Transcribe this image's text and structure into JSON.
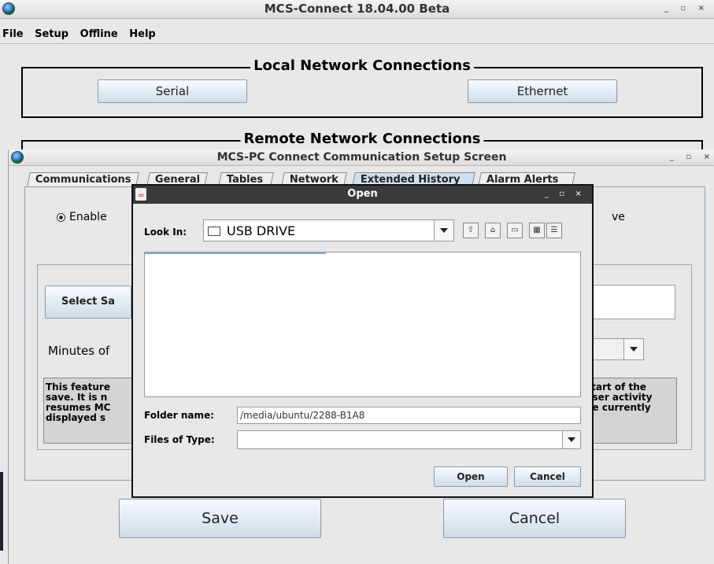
{
  "main_window": {
    "title": "MCS-Connect 18.04.00 Beta",
    "menu": [
      "File",
      "Setup",
      "Offline",
      "Help"
    ],
    "local_group_title": "Local Network Connections",
    "serial_button": "Serial",
    "ethernet_button": "Ethernet",
    "remote_group_title": "Remote Network Connections"
  },
  "setup_window": {
    "title": "MCS-PC Connect Communication Setup Screen",
    "tabs": [
      "Communications",
      "General",
      "Tables",
      "Network",
      "Extended History",
      "Alarm Alerts"
    ],
    "selected_tab": "Extended History",
    "enable_label": "Enable",
    "right_partial_label": "ve",
    "select_save_button": "Select Sa",
    "minutes_label": "Minutes of",
    "info_left": [
      "This feature",
      "save. It is n",
      "resumes MC",
      "displayed s"
    ],
    "info_right": [
      "start of the",
      "user activity",
      "he currently"
    ],
    "save_button": "Save",
    "cancel_button": "Cancel"
  },
  "open_dialog": {
    "title": "Open",
    "look_in_label": "Look In:",
    "look_in_value": "USB DRIVE",
    "toolbar_icons": [
      "up-folder-icon",
      "home-icon",
      "new-folder-icon",
      "list-view-icon",
      "details-view-icon"
    ],
    "folder_name_label": "Folder name:",
    "folder_name_value": "/media/ubuntu/2288-B1A8",
    "files_of_type_label": "Files of Type:",
    "files_of_type_value": "",
    "open_button": "Open",
    "cancel_button": "Cancel"
  },
  "colors": {
    "window_bg": "#e8e8e8",
    "selected_tab": "#cfe0f0",
    "button_gradient_bottom": "#cfdde9"
  }
}
